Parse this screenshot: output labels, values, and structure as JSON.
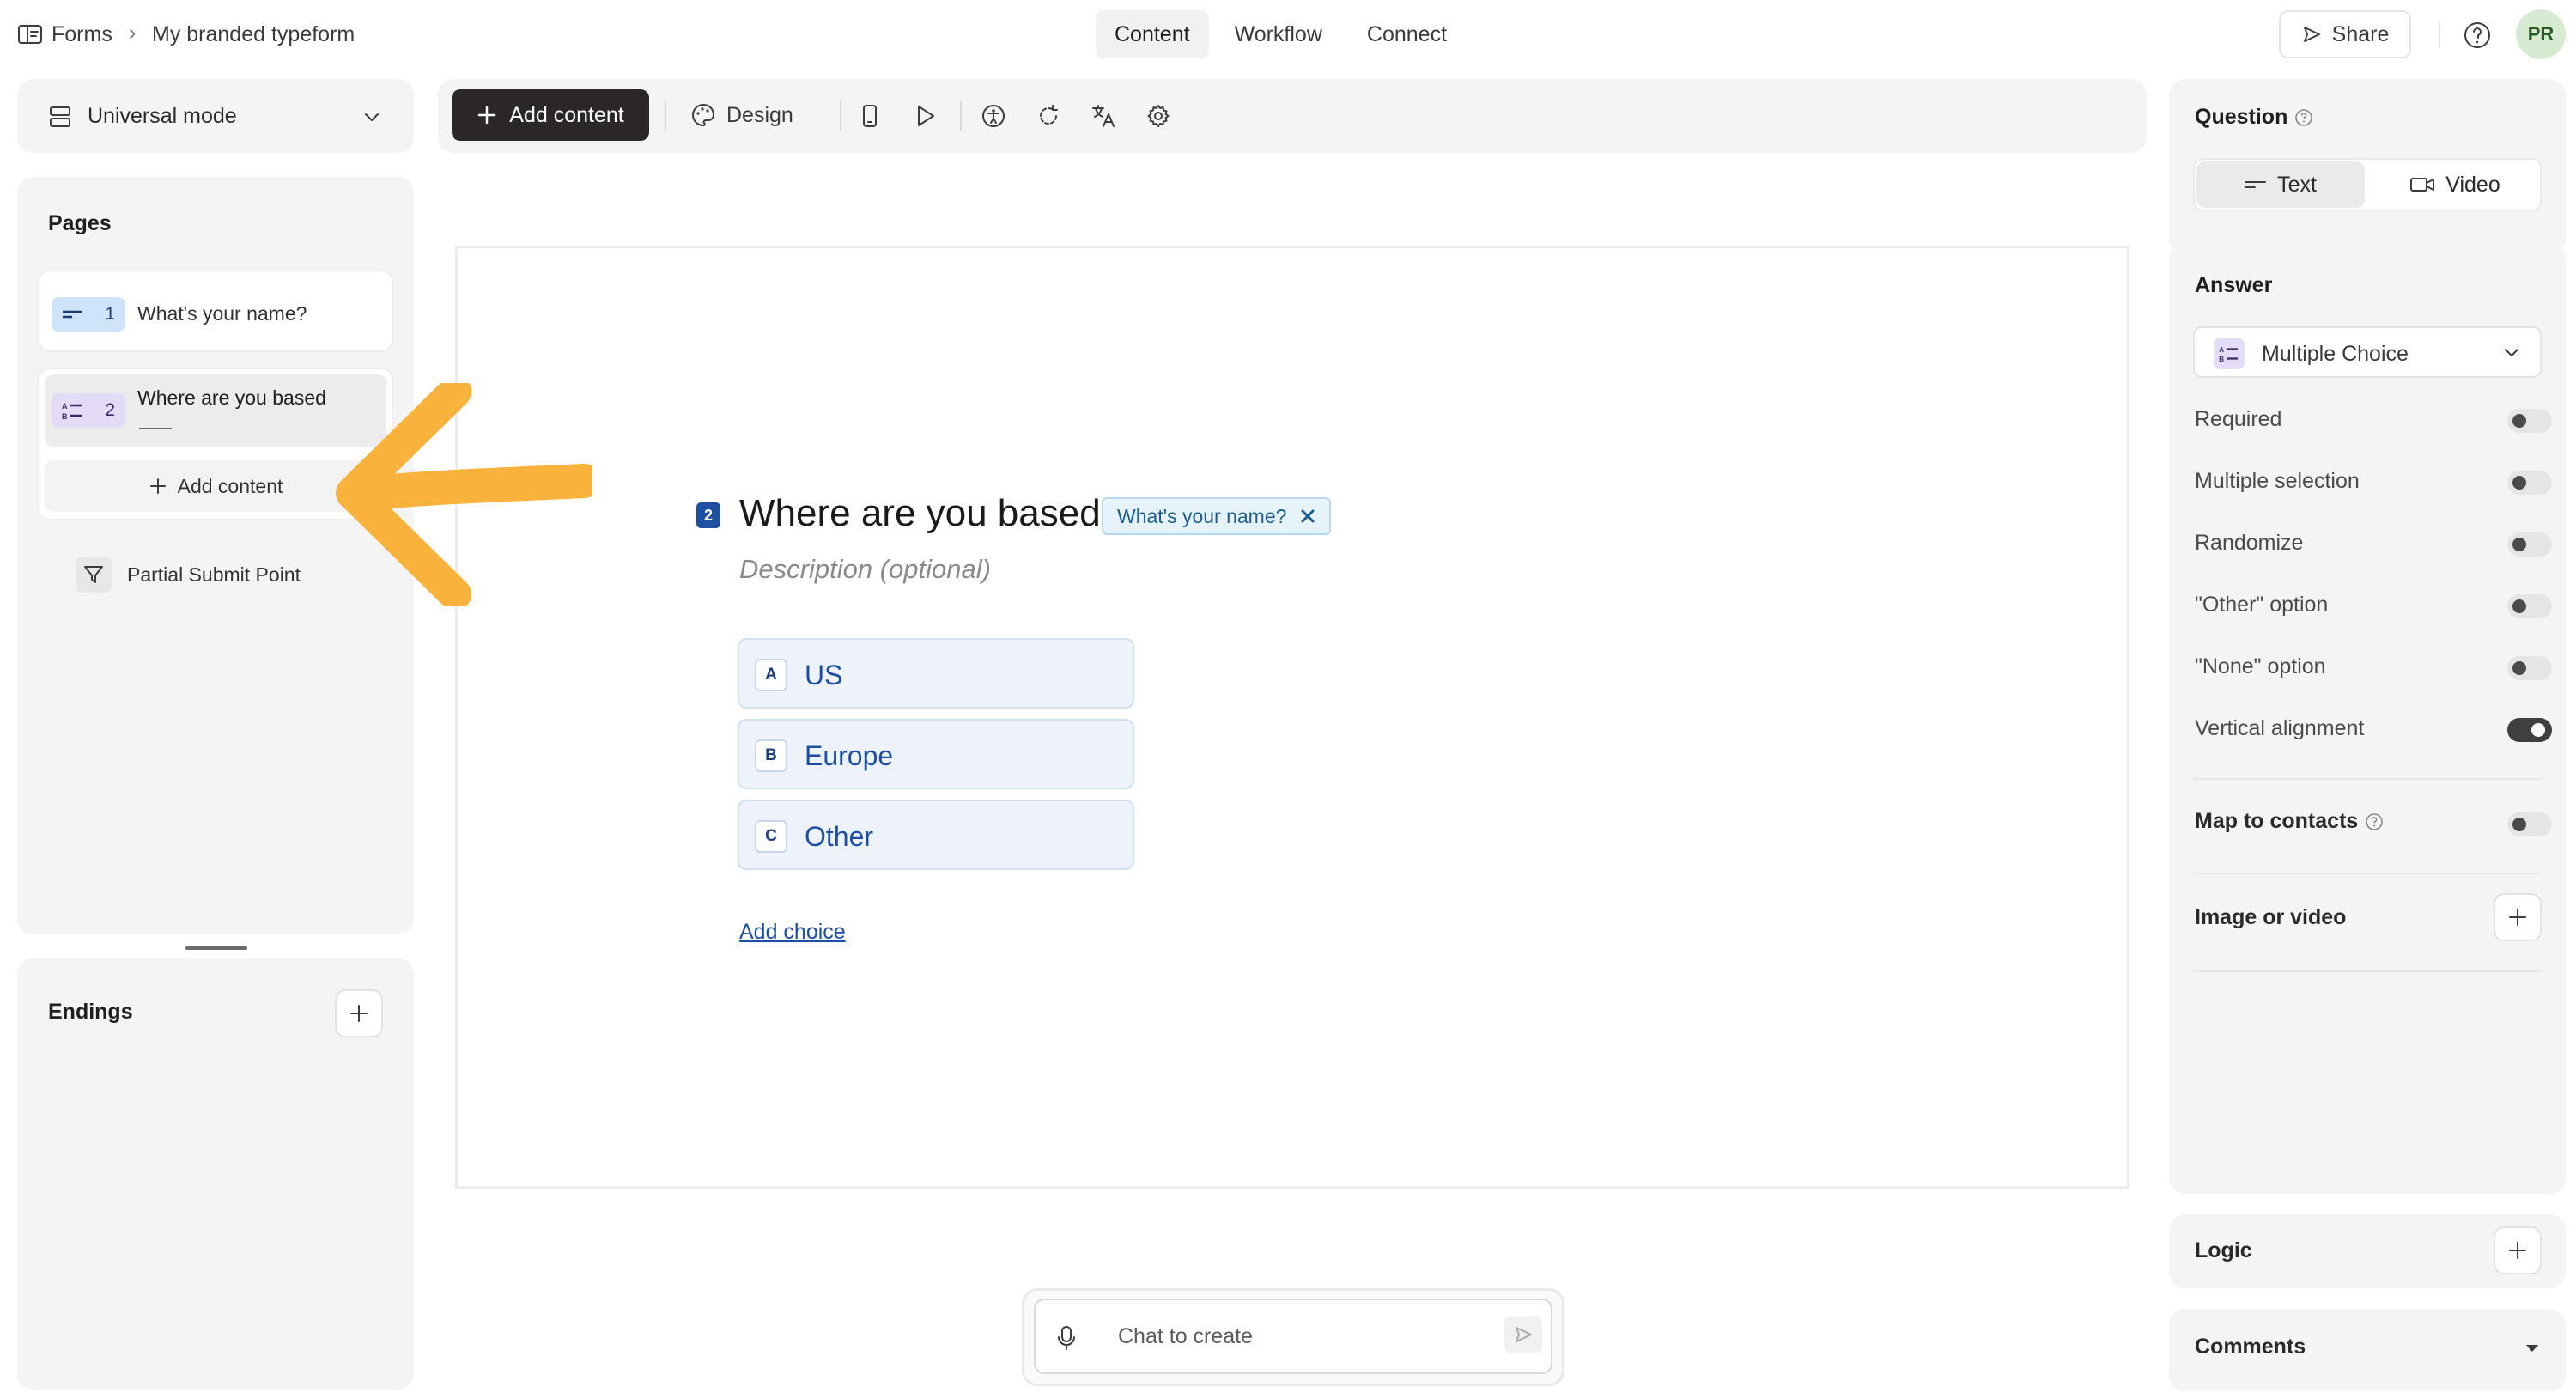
{
  "header": {
    "breadcrumb_root": "Forms",
    "breadcrumb_sep": "›",
    "form_title": "My branded typeform",
    "tabs": [
      {
        "label": "Content",
        "active": true
      },
      {
        "label": "Workflow",
        "active": false
      },
      {
        "label": "Connect",
        "active": false
      }
    ],
    "share_label": "Share",
    "avatar_initials": "PR"
  },
  "left": {
    "mode_label": "Universal mode",
    "pages_title": "Pages",
    "pages": [
      {
        "number": "1",
        "title": "What's your name?",
        "icon": "short-text-icon"
      },
      {
        "number": "2",
        "title": "Where are you based",
        "icon": "multiple-choice-icon",
        "selected": true
      }
    ],
    "add_content_label": "Add content",
    "partial_submit_label": "Partial Submit Point",
    "endings_title": "Endings"
  },
  "toolbar": {
    "add_content_label": "Add content",
    "design_label": "Design",
    "icons": [
      "mobile-preview-icon",
      "play-icon",
      "accessibility-icon",
      "loop-icon",
      "translate-icon",
      "settings-icon"
    ]
  },
  "question": {
    "number": "2",
    "title": "Where are you based",
    "recall_tag": "What's your name?",
    "description_placeholder": "Description (optional)",
    "choices": [
      {
        "key": "A",
        "label": "US"
      },
      {
        "key": "B",
        "label": "Europe"
      },
      {
        "key": "C",
        "label": "Other"
      }
    ],
    "add_choice_label": "Add choice"
  },
  "chat": {
    "placeholder": "Chat to create"
  },
  "right": {
    "question_title": "Question",
    "question_tabs": [
      {
        "label": "Text",
        "active": true
      },
      {
        "label": "Video",
        "active": false
      }
    ],
    "answer_title": "Answer",
    "answer_type": "Multiple Choice",
    "settings": [
      {
        "label": "Required",
        "on": false
      },
      {
        "label": "Multiple selection",
        "on": false
      },
      {
        "label": "Randomize",
        "on": false
      },
      {
        "label": "\"Other\" option",
        "on": false
      },
      {
        "label": "\"None\" option",
        "on": false
      },
      {
        "label": "Vertical alignment",
        "on": true
      }
    ],
    "map_contacts_label": "Map to contacts",
    "map_contacts_on": false,
    "image_video_label": "Image or video",
    "logic_label": "Logic",
    "comments_label": "Comments"
  },
  "colors": {
    "accent_orange": "#f9b23b",
    "question_number_blue": "#1e4fa0",
    "choice_bg": "#eef3fb",
    "dark_button": "#2b2727"
  }
}
